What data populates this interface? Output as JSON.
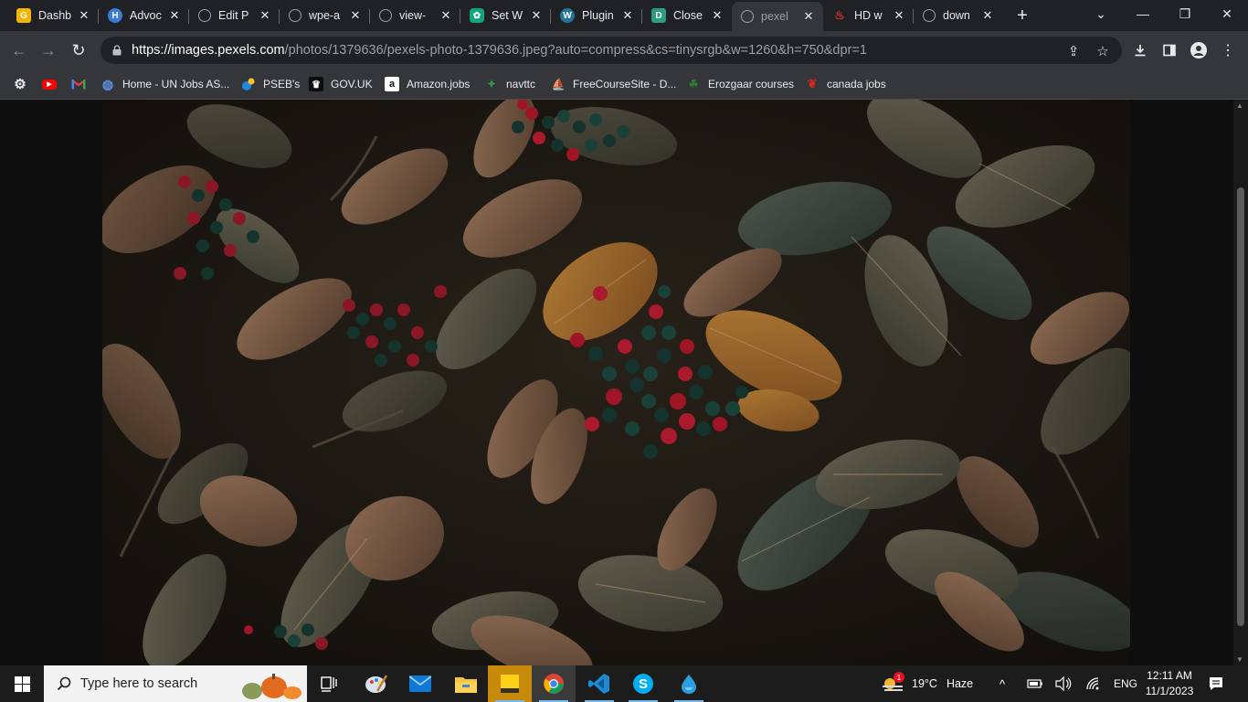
{
  "tabs": [
    {
      "title": "Dashb",
      "icon": "g-logo-icon",
      "color": "#f5b400"
    },
    {
      "title": "Advoc",
      "icon": "h-logo-icon",
      "color": "#3a7bd5"
    },
    {
      "title": "Edit P",
      "icon": "globe-icon",
      "color": "#5f6368"
    },
    {
      "title": "wpe-a",
      "icon": "globe-icon",
      "color": "#5f6368"
    },
    {
      "title": "view-",
      "icon": "globe-icon",
      "color": "#5f6368"
    },
    {
      "title": "Set W",
      "icon": "chatgpt-icon",
      "color": "#10a37f"
    },
    {
      "title": "Plugin",
      "icon": "wordpress-icon",
      "color": "#21759b"
    },
    {
      "title": "Close",
      "icon": "d-logo-icon",
      "color": "#2c9c7a"
    },
    {
      "title": "pexel",
      "icon": "globe-icon",
      "color": "#5f6368",
      "active": true
    },
    {
      "title": "HD w",
      "icon": "flame-icon",
      "color": "#d93025"
    },
    {
      "title": "down",
      "icon": "globe-icon",
      "color": "#5f6368"
    }
  ],
  "url": {
    "host": "https://images.pexels.com",
    "path": "/photos/1379636/pexels-photo-1379636.jpeg?auto=compress&cs=tinysrgb&w=1260&h=750&dpr=1"
  },
  "bookmarks": [
    {
      "label": "",
      "icon": "gear-icon"
    },
    {
      "label": "",
      "icon": "youtube-icon"
    },
    {
      "label": "",
      "icon": "gmail-icon"
    },
    {
      "label": "Home - UN Jobs AS...",
      "icon": "un-icon"
    },
    {
      "label": "PSEB's",
      "icon": "pseb-icon"
    },
    {
      "label": "GOV.UK",
      "icon": "crown-icon"
    },
    {
      "label": "Amazon.jobs",
      "icon": "amazon-icon"
    },
    {
      "label": "navttc",
      "icon": "navttc-icon"
    },
    {
      "label": "FreeCourseSite - D...",
      "icon": "sail-icon"
    },
    {
      "label": "Erozgaar courses",
      "icon": "erozgaar-icon"
    },
    {
      "label": "canada jobs",
      "icon": "maple-leaf-icon"
    }
  ],
  "taskbar": {
    "search_placeholder": "Type here to search",
    "weather_temp": "19°C",
    "weather_desc": "Haze",
    "weather_badge": "1",
    "language": "ENG",
    "time": "12:11 AM",
    "date": "11/1/2023"
  }
}
